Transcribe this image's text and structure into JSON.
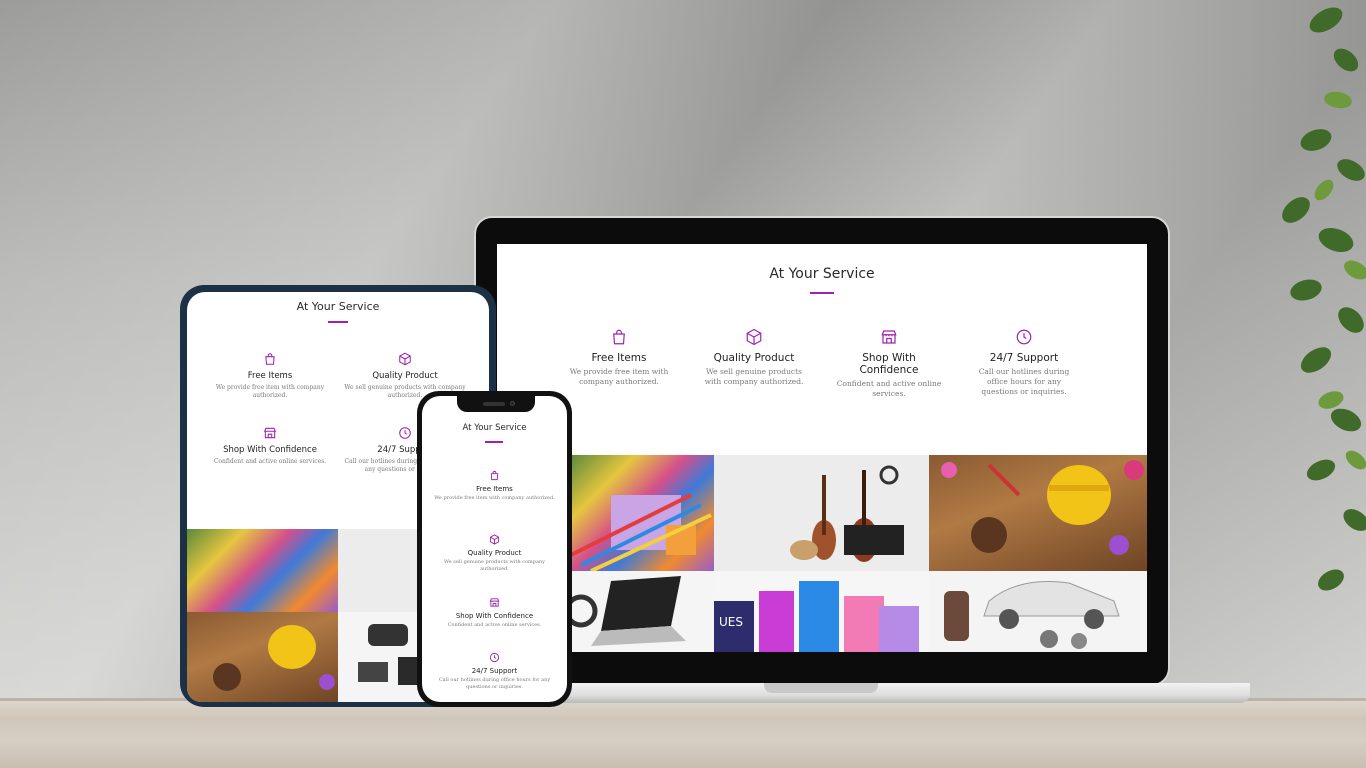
{
  "colors": {
    "accent": "#a020b0",
    "heading": "#2a2a2a",
    "body_text": "#7a7a7a"
  },
  "section": {
    "title": "At Your Service"
  },
  "services": [
    {
      "icon": "shopping-bag-icon",
      "name": "Free Items",
      "desc": "We provide free item with company authorized."
    },
    {
      "icon": "box-icon",
      "name": "Quality Product",
      "desc": "We sell genuine products with company authorized."
    },
    {
      "icon": "storefront-icon",
      "name": "Shop With Confidence",
      "desc": "Confident and active online services."
    },
    {
      "icon": "clock-icon",
      "name": "24/7 Support",
      "desc": "Call our hotlines during office hours for any questions or inquiries."
    }
  ],
  "gallery": [
    {
      "name": "stationery-image"
    },
    {
      "name": "musical-instruments-image"
    },
    {
      "name": "garden-tools-image"
    },
    {
      "name": "electronics-image"
    },
    {
      "name": "gift-bags-image"
    },
    {
      "name": "car-parts-image"
    }
  ]
}
